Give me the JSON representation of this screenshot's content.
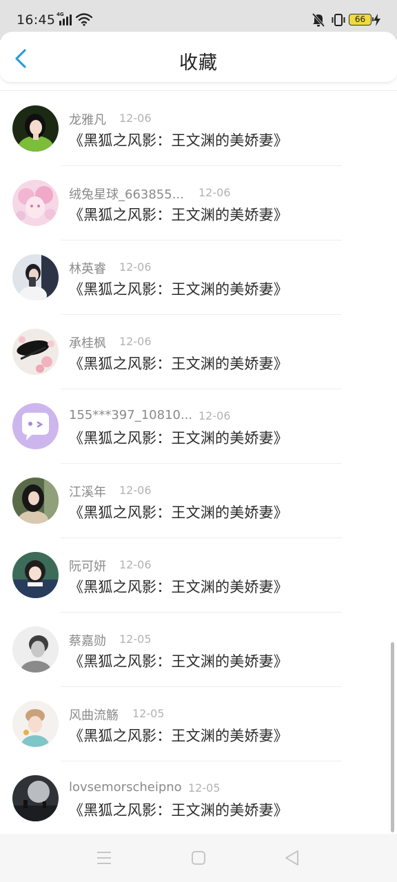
{
  "status": {
    "time": "16:45",
    "network": "4G",
    "battery": "66",
    "icons": [
      "signal-icon",
      "wifi-icon",
      "mute-bell-icon",
      "vibrate-icon",
      "battery-icon",
      "charging-icon"
    ]
  },
  "header": {
    "title": "收藏",
    "back_icon": "chevron-left-icon",
    "accent": "#2d9cdb"
  },
  "items": [
    {
      "name": "龙雅凡",
      "date": "12-06",
      "text": "《黑狐之风影：王文渊的美娇妻》"
    },
    {
      "name": "绒兔星球_663855...",
      "date": "12-06",
      "text": "《黑狐之风影：王文渊的美娇妻》"
    },
    {
      "name": "林英睿",
      "date": "12-06",
      "text": "《黑狐之风影：王文渊的美娇妻》"
    },
    {
      "name": "承桂枫",
      "date": "12-06",
      "text": "《黑狐之风影：王文渊的美娇妻》"
    },
    {
      "name": "155***397_10810...",
      "date": "12-06",
      "text": "《黑狐之风影：王文渊的美娇妻》"
    },
    {
      "name": "江溪年",
      "date": "12-06",
      "text": "《黑狐之风影：王文渊的美娇妻》"
    },
    {
      "name": "阮可妍",
      "date": "12-06",
      "text": "《黑狐之风影：王文渊的美娇妻》"
    },
    {
      "name": "蔡嘉勋",
      "date": "12-05",
      "text": "《黑狐之风影：王文渊的美娇妻》"
    },
    {
      "name": "风曲流觞",
      "date": "12-05",
      "text": "《黑狐之风影：王文渊的美娇妻》"
    },
    {
      "name": "lovsemorscheipno",
      "date": "12-05",
      "text": "《黑狐之风影：王文渊的美娇妻》"
    }
  ],
  "nav": {
    "icons": [
      "menu-icon",
      "home-square-icon",
      "back-triangle-icon"
    ]
  }
}
